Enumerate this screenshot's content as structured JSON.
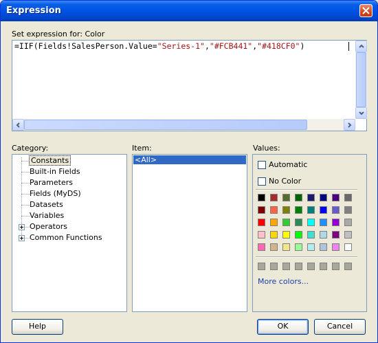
{
  "window": {
    "title": "Expression"
  },
  "expression": {
    "label": "Set expression for: Color",
    "parts": [
      {
        "text": "=IIF(Fields!SalesPerson.Value=",
        "color": "#000000"
      },
      {
        "text": "\"Series-1\"",
        "color": "#a31515"
      },
      {
        "text": ",",
        "color": "#000000"
      },
      {
        "text": "\"#FCB441\"",
        "color": "#a31515"
      },
      {
        "text": ",",
        "color": "#000000"
      },
      {
        "text": "\"#418CF0\"",
        "color": "#a31515"
      },
      {
        "text": ")",
        "color": "#000000"
      }
    ]
  },
  "category": {
    "label": "Category:",
    "items": [
      "Constants",
      "Built-in Fields",
      "Parameters",
      "Fields (MyDS)",
      "Datasets",
      "Variables",
      "Operators",
      "Common Functions"
    ],
    "selected": "Constants"
  },
  "item": {
    "label": "Item:",
    "items": [
      "<All>"
    ]
  },
  "values": {
    "label": "Values:",
    "automatic": "Automatic",
    "no_color": "No Color",
    "more_colors": "More colors...",
    "palette": [
      [
        "#000000",
        "#a52a2a",
        "#556b2f",
        "#006400",
        "#191970",
        "#000080",
        "#4b0082",
        "#696969"
      ],
      [
        "#800000",
        "#ff6347",
        "#808000",
        "#008000",
        "#008080",
        "#0000ff",
        "#6a5acd",
        "#808080"
      ],
      [
        "#ff0000",
        "#ffa500",
        "#32cd32",
        "#2e8b57",
        "#00ffff",
        "#1e90ff",
        "#9400d3",
        "#a9a9a9"
      ],
      [
        "#ffc0cb",
        "#ffd700",
        "#ffff00",
        "#00ff00",
        "#40e0d0",
        "#add8e6",
        "#800080",
        "#c0c0c0"
      ],
      [
        "#ff69b4",
        "#d2b48c",
        "#f0e68c",
        "#98fb98",
        "#afeeee",
        "#b0c4de",
        "#ee82ee",
        "#ffffff"
      ]
    ],
    "recent": [
      "#a8a89a",
      "#a8a89a",
      "#a8a89a",
      "#a8a89a",
      "#a8a89a",
      "#a8a89a",
      "#a8a89a",
      "#a8a89a"
    ]
  },
  "buttons": {
    "help": "Help",
    "ok": "OK",
    "cancel": "Cancel"
  }
}
